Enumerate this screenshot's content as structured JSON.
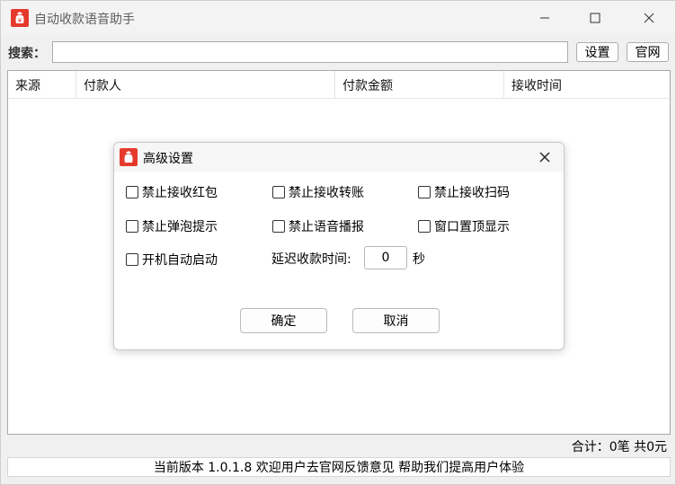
{
  "window": {
    "title": "自动收款语音助手",
    "accent": "#e53a2b"
  },
  "toolbar": {
    "search_label": "搜索：",
    "search_value": "",
    "settings_label": "设置",
    "official_label": "官网"
  },
  "table": {
    "columns": [
      "来源",
      "付款人",
      "付款金额",
      "接收时间"
    ],
    "rows": []
  },
  "summary": {
    "text": "合计：0笔 共0元"
  },
  "status": {
    "text": "当前版本 1.0.1.8 欢迎用户去官网反馈意见 帮助我们提高用户体验"
  },
  "dialog": {
    "title": "高级设置",
    "options": [
      {
        "label": "禁止接收红包",
        "checked": false
      },
      {
        "label": "禁止接收转账",
        "checked": false
      },
      {
        "label": "禁止接收扫码",
        "checked": false
      },
      {
        "label": "禁止弹泡提示",
        "checked": false
      },
      {
        "label": "禁止语音播报",
        "checked": false
      },
      {
        "label": "窗口置顶显示",
        "checked": false
      },
      {
        "label": "开机自动启动",
        "checked": false
      }
    ],
    "delay_label": "延迟收款时间:",
    "delay_value": "0",
    "delay_unit": "秒",
    "ok_label": "确定",
    "cancel_label": "取消"
  }
}
